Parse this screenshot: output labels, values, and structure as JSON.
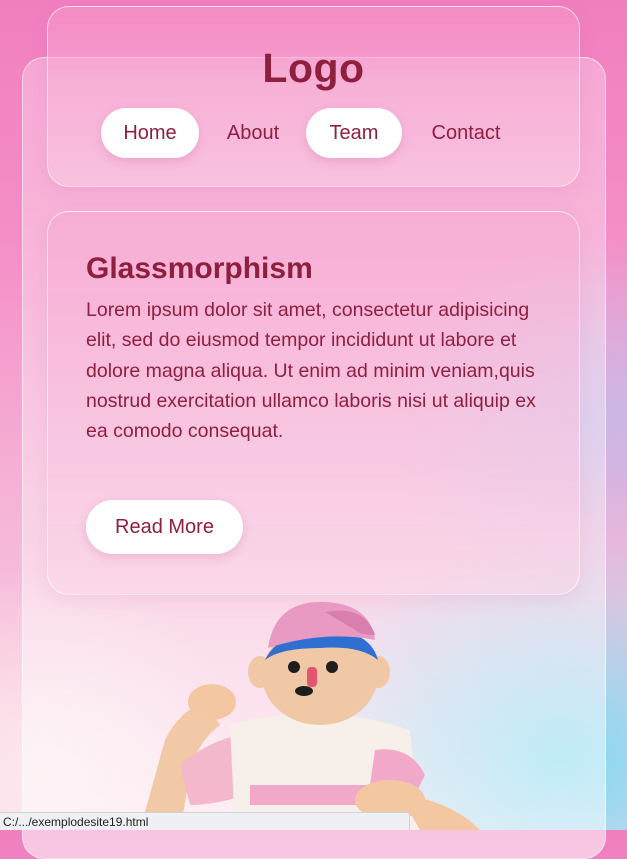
{
  "header": {
    "logo": "Logo",
    "nav": [
      {
        "label": "Home",
        "active": true
      },
      {
        "label": "About",
        "active": false
      },
      {
        "label": "Team",
        "active": true
      },
      {
        "label": "Contact",
        "active": false
      }
    ]
  },
  "card": {
    "title": "Glassmorphism",
    "body": "Lorem ipsum dolor sit amet, consectetur adipisicing elit, sed do eiusmod tempor incididunt ut labore et dolore magna aliqua. Ut enim ad minim veniam,quis nostrud exercitation ullamco laboris nisi ut aliquip ex ea comodo consequat.",
    "button_label": "Read More"
  },
  "illustration": {
    "name": "3d-character-illustration"
  },
  "status_bar": {
    "url": "C:/.../exemplodesite19.html"
  },
  "colors": {
    "text": "#8f1f3f",
    "background_pink": "#f07fbf",
    "background_blue": "#7fd9f2",
    "button_bg": "#ffffff"
  }
}
